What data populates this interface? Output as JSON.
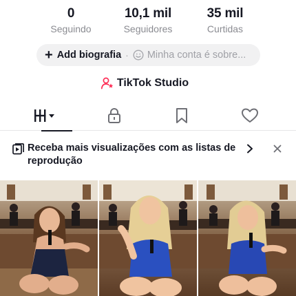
{
  "stats": [
    {
      "value": "0",
      "label": "Seguindo"
    },
    {
      "value": "10,1 mil",
      "label": "Seguidores"
    },
    {
      "value": "35 mil",
      "label": "Curtidas"
    }
  ],
  "bio": {
    "add_label": "Add biografia",
    "separator": "·",
    "placeholder": "Minha conta é sobre..."
  },
  "studio": {
    "label": "TikTok Studio",
    "icon": "person-star-icon",
    "icon_color": "#fe2c55"
  },
  "tabs": [
    {
      "name": "videos-grid-tab",
      "icon": "grid-bars-icon",
      "active": true
    },
    {
      "name": "private-tab",
      "icon": "lock-icon",
      "active": false
    },
    {
      "name": "saved-tab",
      "icon": "bookmark-icon",
      "active": false
    },
    {
      "name": "liked-tab",
      "icon": "heart-icon",
      "active": false
    }
  ],
  "banner": {
    "text": "Receba mais visualizações com as listas de reprodução",
    "icon": "playlist-icon"
  },
  "videos": [
    {
      "pose": "singing-holding-microphone"
    },
    {
      "pose": "pointing-at-camera"
    },
    {
      "pose": "singing-with-hand-out"
    }
  ],
  "colors": {
    "text": "#161823",
    "secondary_text": "#8a8b91",
    "pill_background": "#f1f1f2",
    "accent": "#fe2c55"
  }
}
